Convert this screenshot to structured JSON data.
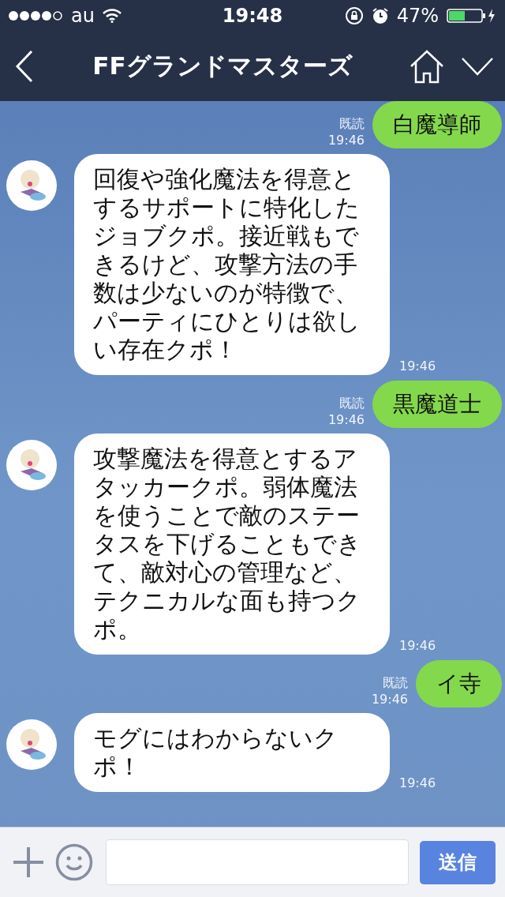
{
  "status_bar": {
    "carrier": "au",
    "time": "19:48",
    "battery_percent": "47%"
  },
  "nav_bar": {
    "title": "FFグランドマスターズ"
  },
  "messages": [
    {
      "kind": "sent",
      "read_label": "既読",
      "time": "19:46",
      "text": "白魔導師"
    },
    {
      "kind": "received",
      "time": "19:46",
      "text": "回復や強化魔法を得意とするサポートに特化したジョブクポ。接近戦もできるけど、攻撃方法の手数は少ないのが特徴で、パーティにひとりは欲しい存在クポ！"
    },
    {
      "kind": "sent",
      "read_label": "既読",
      "time": "19:46",
      "text": "黒魔道士"
    },
    {
      "kind": "received",
      "time": "19:46",
      "text": "攻撃魔法を得意とするアタッカークポ。弱体魔法を使うことで敵のステータスを下げることもできて、敵対心の管理など、テクニカルな面も持つクポ。"
    },
    {
      "kind": "sent",
      "read_label": "既読",
      "time": "19:46",
      "text": "イ寺"
    },
    {
      "kind": "received",
      "time": "19:46",
      "text": "モグにはわからないクポ！"
    }
  ],
  "input_bar": {
    "send_label": "送信"
  }
}
